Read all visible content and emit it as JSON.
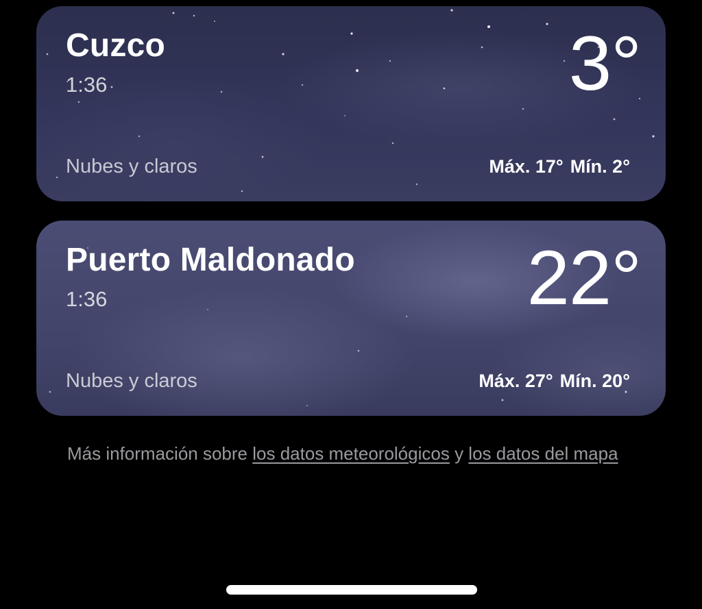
{
  "locations": [
    {
      "city": "Cuzco",
      "time": "1:36",
      "temperature": "3°",
      "condition": "Nubes y claros",
      "high": "Máx. 17°",
      "low": "Mín. 2°"
    },
    {
      "city": "Puerto Maldonado",
      "time": "1:36",
      "temperature": "22°",
      "condition": "Nubes y claros",
      "high": "Máx. 27°",
      "low": "Mín. 20°"
    }
  ],
  "footer": {
    "prefix": "Más información sobre ",
    "weather_data_link": "los datos meteorológicos",
    "connector": " y ",
    "map_data_link": "los datos del mapa"
  },
  "colors": {
    "background": "#000000",
    "card_night": "#33355a",
    "card_night_cloudy": "#43456b",
    "footer_text": "#9a9a9f"
  }
}
